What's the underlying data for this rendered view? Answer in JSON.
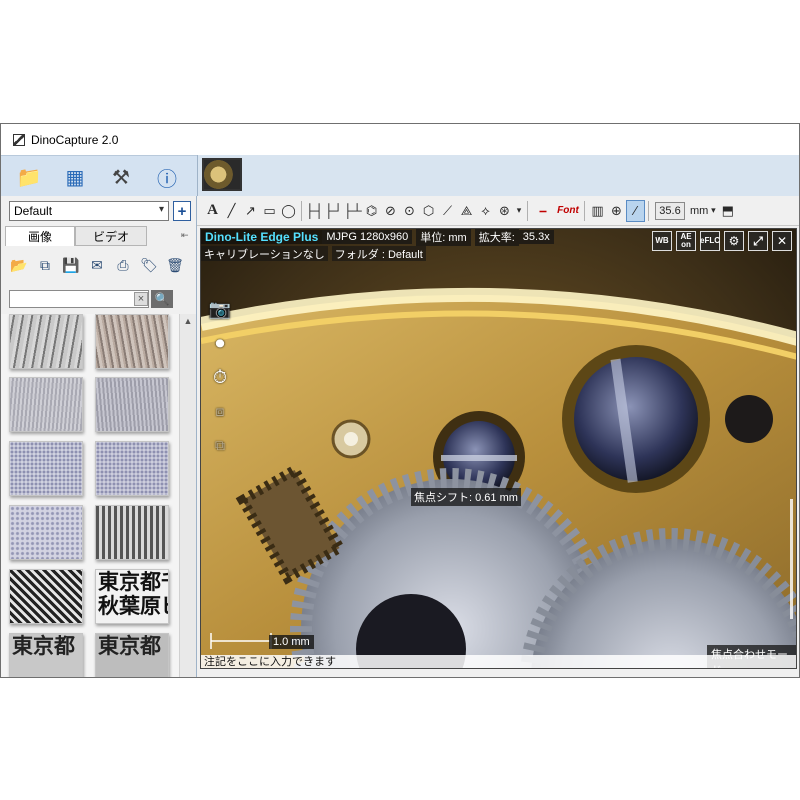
{
  "window": {
    "title": "DinoCapture 2.0"
  },
  "nav": {
    "buttons": [
      {
        "name": "open-folder-button",
        "glyph": "📁"
      },
      {
        "name": "gallery-view-button",
        "glyph": "▦"
      },
      {
        "name": "tools-button",
        "glyph": "⚒"
      },
      {
        "name": "info-button",
        "glyph": "ⓘ"
      }
    ]
  },
  "sidebar": {
    "profile": "Default",
    "add_glyph": "+",
    "tabs": [
      {
        "label": "画像"
      },
      {
        "label": "ビデオ"
      }
    ],
    "search_placeholder": "",
    "clear_glyph": "×",
    "search_glyph": "🔍",
    "thumbnails": [
      {
        "texture": "scratch"
      },
      {
        "texture": "rust"
      },
      {
        "texture": "brushed"
      },
      {
        "texture": "brushed"
      },
      {
        "texture": "speckle"
      },
      {
        "texture": "speckle"
      },
      {
        "texture": "speckle"
      },
      {
        "texture": "stripes"
      },
      {
        "texture": "mesh"
      },
      {
        "text": "東京都千 秋葉原ビ"
      },
      {
        "text": "東京都"
      },
      {
        "text": "東京都"
      }
    ]
  },
  "toolbar": {
    "tools": [
      "A",
      "╱",
      "↗",
      "▭",
      "◯",
      "├┤",
      "├┘",
      "├┴",
      "⌬",
      "⊘",
      "⊙",
      "⬡",
      "⟋",
      "⟁",
      "⟡",
      "⊛",
      "▾",
      "⎯",
      "Font",
      "▥",
      "⊕",
      "⁄"
    ],
    "value": "35.6",
    "unit": "mm"
  },
  "viewer": {
    "brand": "Dino-Lite Edge Plus",
    "resolution": "MJPG 1280x960",
    "unit_label": "単位: mm",
    "magnification_label": "拡大率:",
    "magnification": "35.3x",
    "calibration": "キャリブレーションなし",
    "folder_label": "フォルダ : Default",
    "focus_shift": "焦点シフト: 0.61 mm",
    "scale": "1.0 mm",
    "focus_mode": "焦点合わせモード",
    "annotation_placeholder": "注記をここに入力できます",
    "overlay_buttons": [
      "WB",
      "AE on",
      "eFLC",
      "⚙",
      "⤢",
      "✕"
    ]
  }
}
